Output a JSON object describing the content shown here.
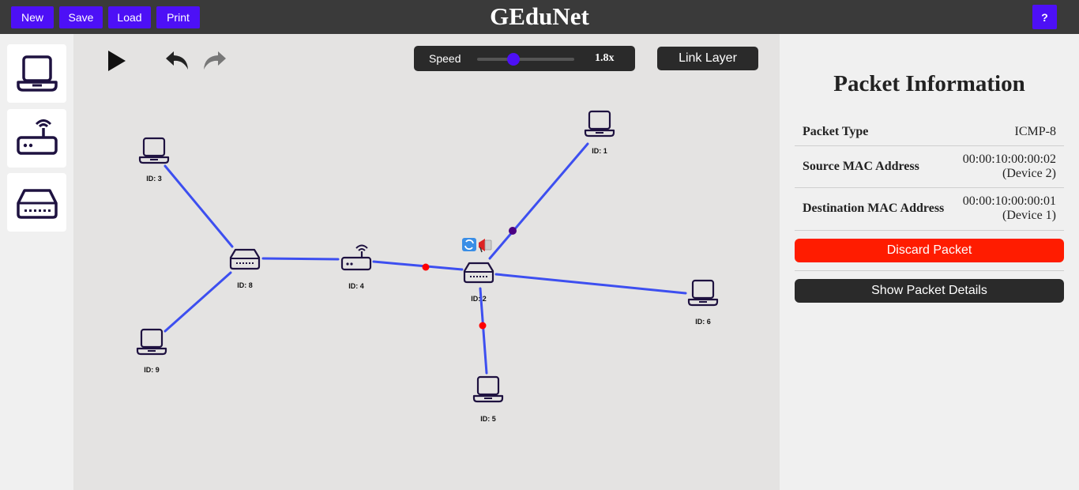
{
  "app": {
    "title": "GEduNet",
    "help_label": "?"
  },
  "toolbar": {
    "new_label": "New",
    "save_label": "Save",
    "load_label": "Load",
    "print_label": "Print"
  },
  "palette": {
    "items": [
      {
        "icon": "laptop-icon"
      },
      {
        "icon": "router-icon"
      },
      {
        "icon": "switch-icon"
      }
    ]
  },
  "controls": {
    "play_icon": "play-icon",
    "undo_icon": "undo-icon",
    "redo_icon": "redo-icon",
    "speed_label": "Speed",
    "speed_value": "1.8x",
    "speed_fraction": 0.37,
    "layer_label": "Link Layer"
  },
  "network": {
    "devices": [
      {
        "id": "1",
        "label": "ID: 1",
        "type": "laptop"
      },
      {
        "id": "2",
        "label": "ID: 2",
        "type": "switch"
      },
      {
        "id": "3",
        "label": "ID: 3",
        "type": "laptop"
      },
      {
        "id": "4",
        "label": "ID: 4",
        "type": "router"
      },
      {
        "id": "5",
        "label": "ID: 5",
        "type": "laptop"
      },
      {
        "id": "6",
        "label": "ID: 6",
        "type": "laptop"
      },
      {
        "id": "8",
        "label": "ID: 8",
        "type": "switch"
      },
      {
        "id": "9",
        "label": "ID: 9",
        "type": "laptop"
      }
    ],
    "links": [
      [
        "3",
        "8"
      ],
      [
        "9",
        "8"
      ],
      [
        "8",
        "4"
      ],
      [
        "4",
        "2"
      ],
      [
        "2",
        "1"
      ],
      [
        "2",
        "6"
      ],
      [
        "2",
        "5"
      ]
    ],
    "packet_colors": {
      "red": "#ff0000",
      "purple": "#4b0082"
    },
    "link_color": "#3d4ff0",
    "device_color": "#1e1240"
  },
  "packet_info": {
    "title": "Packet Information",
    "rows": [
      {
        "key": "Packet Type",
        "value_line1": "ICMP-8",
        "value_line2": ""
      },
      {
        "key": "Source MAC Address",
        "value_line1": "00:00:10:00:00:02",
        "value_line2": "(Device 2)"
      },
      {
        "key": "Destination MAC Address",
        "value_line1": "00:00:10:00:00:01",
        "value_line2": "(Device 1)"
      }
    ],
    "discard_label": "Discard Packet",
    "details_label": "Show Packet Details",
    "discard_color": "#ff1c00"
  }
}
